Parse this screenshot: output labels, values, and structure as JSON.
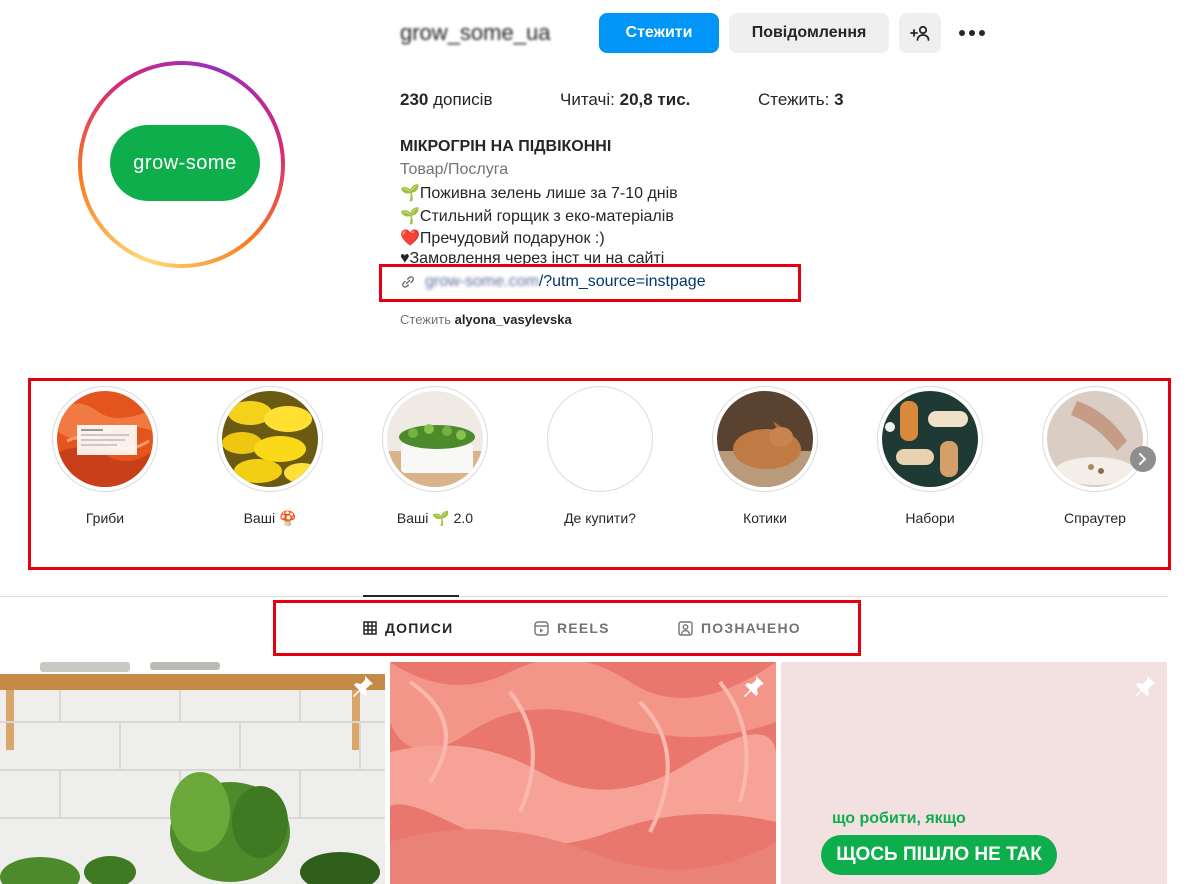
{
  "profile": {
    "username": "grow_some_ua",
    "avatar_text": "grow-some",
    "follow_label": "Стежити",
    "message_label": "Повідомлення",
    "add_user_symbol": "+",
    "more_symbol": "•••"
  },
  "stats": {
    "posts_count": "230",
    "posts_label": "дописів",
    "followers_label": "Читачі:",
    "followers_count": "20,8 тис.",
    "following_label": "Стежить:",
    "following_count": "3"
  },
  "bio": {
    "name": "МІКРОГРІН НА ПІДВІКОННІ",
    "category": "Товар/Послуга",
    "lines": [
      "🌱Поживна зелень лише за 7-10 днів",
      "🌱Стильний горщик з еко-матеріалів",
      "❤️Пречудовий подарунок :)",
      "♥Замовлення через інст чи на сайті"
    ],
    "link_domain": "grow-some.com",
    "link_path": "/?utm_source=instpage",
    "followed_by_label": "Стежить",
    "followed_by_user": "alyona_vasylevska"
  },
  "highlights": [
    {
      "label": "Гриби"
    },
    {
      "label": "Ваші 🍄"
    },
    {
      "label": "Ваші 🌱 2.0"
    },
    {
      "label": "Де купити?"
    },
    {
      "label": "Котики"
    },
    {
      "label": "Набори"
    },
    {
      "label": "Спраутер"
    }
  ],
  "tabs": [
    {
      "label": "ДОПИСИ",
      "icon": "grid-icon",
      "active": true
    },
    {
      "label": "REELS",
      "icon": "reels-icon",
      "active": false
    },
    {
      "label": "ПОЗНАЧЕНО",
      "icon": "tagged-icon",
      "active": false
    }
  ],
  "posts": {
    "third_line1": "що робити, якщо",
    "third_line2": "ЩОСЬ ПІШЛО НЕ ТАК"
  },
  "colors": {
    "accent_blue": "#0095f6",
    "brand_green": "#0fae4c",
    "highlight_box": "#e3000f"
  }
}
